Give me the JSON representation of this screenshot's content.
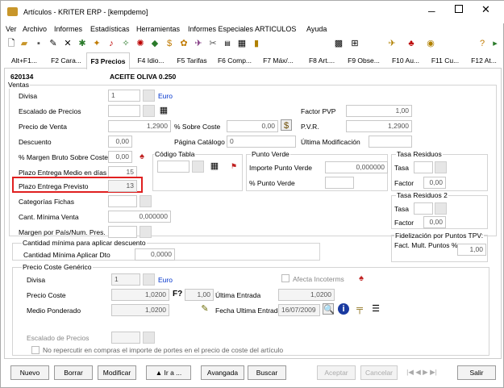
{
  "window": {
    "title": "Artículos - KRITER ERP - [kempdemo]"
  },
  "menu": [
    "Ver",
    "Archivo",
    "Informes",
    "Estadísticas",
    "Herramientas",
    "Informes Especiales ARTICULOS",
    "Ayuda"
  ],
  "tabs": [
    "Alt+F1...",
    "F2 Cara...",
    "F3 Precios",
    "F4 Idio...",
    "F5 Tarifas",
    "F6 Comp...",
    "F7 Máx/...",
    "F8 Art....",
    "F9 Obse...",
    "F10 Au...",
    "F11 Cu...",
    "F12 At..."
  ],
  "article": {
    "code": "620134",
    "name": "ACEITE OLIVA 0.250"
  },
  "ventas": {
    "group": "Ventas",
    "divisa_label": "Divisa",
    "divisa_value": "1",
    "divisa_currency": "Euro",
    "escalado_label": "Escalado de Precios",
    "precio_venta_label": "Precio de Venta",
    "precio_venta": "1,2900",
    "sobre_coste_label": "% Sobre Coste",
    "sobre_coste": "0,00",
    "descuento_label": "Descuento",
    "descuento": "0,00",
    "pagina_label": "Página Catálogo",
    "pagina": "0",
    "margen_label": "% Margen Bruto Sobre Coste",
    "margen": "0,00",
    "codigo_tabla_label": "Código Tabla",
    "plazo_medio_label": "Plazo Entrega Medio en días",
    "plazo_medio": "15",
    "plazo_previsto_label": "Plazo Entrega Previsto",
    "plazo_previsto": "13",
    "categorias_label": "Categorías Fichas",
    "cant_minima_label": "Cant. Mínima Venta",
    "cant_minima": "0,000000",
    "margen_pais_label": "Margen por País/Num. Pres.",
    "factor_pvp_label": "Factor PVP",
    "factor_pvp": "1,00",
    "pvr_label": "P.V.R.",
    "pvr": "1,2900",
    "ultima_mod_label": "Última Modificación"
  },
  "punto_verde": {
    "group": "Punto Verde",
    "importe_label": "Importe Punto Verde",
    "importe": "0,000000",
    "pct_label": "% Punto Verde"
  },
  "tasa1": {
    "group": "Tasa Residuos",
    "tasa_label": "Tasa",
    "factor_label": "Factor",
    "factor": "0,00"
  },
  "tasa2": {
    "group": "Tasa Residuos 2",
    "tasa_label": "Tasa",
    "factor_label": "Factor",
    "factor": "0,00"
  },
  "fidel": {
    "group": "Fidelización por Puntos TPV:",
    "label": "Fact. Mult. Puntos %",
    "value": "1,00"
  },
  "cant_dto": {
    "group": "Cantidad mínima para aplicar descuento",
    "label": "Cantidad Mínima Aplicar Dto",
    "value": "0,0000"
  },
  "coste": {
    "group": "Precio Coste Genérico",
    "divisa_label": "Divisa",
    "divisa_value": "1",
    "divisa_currency": "Euro",
    "afecta_label": "Afecta Incoterms",
    "precio_label": "Precio Coste",
    "precio": "1,0200",
    "f_label": "F?",
    "f_value": "1,00",
    "ultima_entrada_label": "Última Entrada",
    "ultima_entrada": "1,0200",
    "medio_label": "Medio Ponderado",
    "medio": "1,0200",
    "fecha_label": "Fecha Ultima Entrada",
    "fecha": "16/07/2009",
    "escalado_label": "Escalado de Precios",
    "no_repercutir_label": "No repercutir en compras el importe de portes en el precio de coste del artículo"
  },
  "buttons": {
    "nuevo": "Nuevo",
    "borrar": "Borrar",
    "modificar": "Modificar",
    "ira": "▲ Ir a ...",
    "avanzada": "Avangada",
    "buscar": "Buscar",
    "aceptar": "Aceptar",
    "cancelar": "Cancelar",
    "nav": "|◀ ◀ ▶ ▶|",
    "salir": "Salir"
  },
  "colors": {
    "highlight": "#e02020",
    "link": "#0033cc"
  }
}
